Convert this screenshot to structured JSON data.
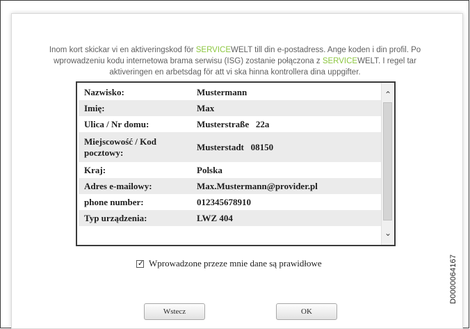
{
  "intro": {
    "part1": "Inom kort skickar vi en aktiveringskod för ",
    "brand_a": "SERVICE",
    "brand_b": "WELT",
    "part2": " till din e-postadress. Ange koden i din profil. Po wprowadzeniu kodu internetowa brama serwisu (ISG) zostanie połączona z ",
    "brand2_a": "SERVICE",
    "brand2_b": "WELT",
    "part3": ". I regel tar aktiveringen en arbetsdag för att vi ska hinna kontrollera dina uppgifter."
  },
  "colors": {
    "accent": "#8cc63f"
  },
  "rows": [
    {
      "label": "Nazwisko:",
      "value": "Mustermann"
    },
    {
      "label": "Imię:",
      "value": "Max"
    },
    {
      "label": "Ulica / Nr domu:",
      "value": "Musterstraße   22a"
    },
    {
      "label": "Miejscowość / Kod pocztowy:",
      "value": "Musterstadt   08150"
    },
    {
      "label": "Kraj:",
      "value": "Polska"
    },
    {
      "label": "Adres e-mailowy:",
      "value": "Max.Mustermann@provider.pl"
    },
    {
      "label": "phone number:",
      "value": "012345678910"
    },
    {
      "label": "Typ urządzenia:",
      "value": "LWZ 404"
    }
  ],
  "scrollbar": {
    "up_icon": "chevron-up-icon",
    "down_icon": "chevron-down-icon"
  },
  "confirm": {
    "checked": true,
    "label": "Wprowadzone przeze mnie dane są prawidłowe"
  },
  "buttons": {
    "back_label": "Wstecz",
    "ok_label": "OK"
  },
  "doc_id": "D0000064167"
}
